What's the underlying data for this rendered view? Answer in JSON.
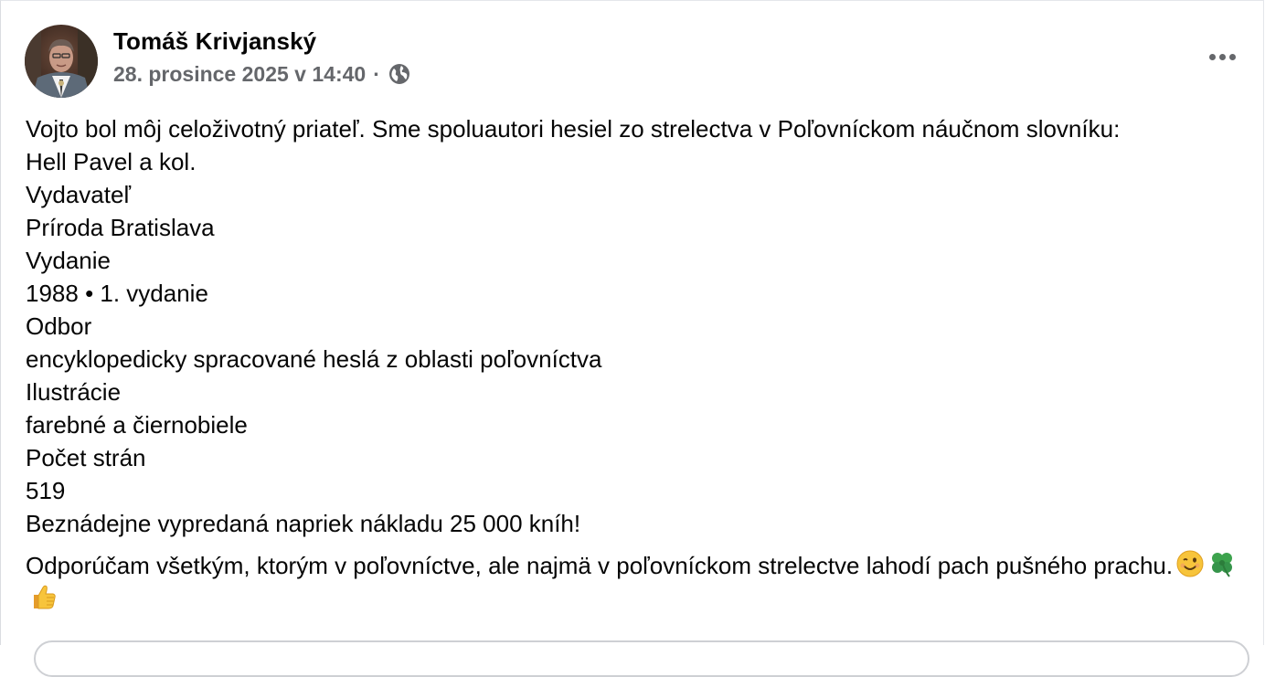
{
  "post": {
    "author": "Tomáš Krivjanský",
    "timestamp": "28. prosince 2025 v 14:40",
    "separator": "·",
    "privacy_icon": "globe-icon",
    "more_icon": "more-options-icon"
  },
  "content": {
    "lines": [
      "Vojto bol môj celoživotný priateľ. Sme spoluautori hesiel zo strelectva v Poľovníckom náučnom slovníku:",
      "Hell Pavel a kol.",
      "Vydavateľ",
      "Príroda Bratislava",
      "Vydanie",
      "1988 • 1. vydanie",
      "Odbor",
      "encyklopedicky spracované heslá z oblasti poľovníctva",
      "Ilustrácie",
      "farebné a čiernobiele",
      "Počet strán",
      "519",
      "Beznádejne vypredaná napriek nákladu 25 000 kníh!"
    ],
    "paragraph2": "Odporúčam všetkým, ktorým v poľovníctve, ale najmä v poľovníckom strelectve lahodí pach pušného prachu.",
    "emojis": [
      "winking-face-emoji",
      "four-leaf-clover-emoji",
      "thumbs-up-emoji"
    ]
  },
  "colors": {
    "text": "#050505",
    "secondary_text": "#65676b",
    "border": "#dadde1"
  }
}
